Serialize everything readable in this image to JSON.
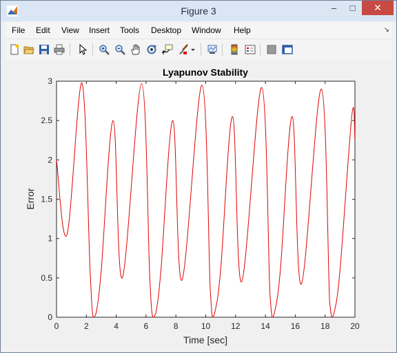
{
  "window": {
    "title": "Figure 3",
    "controls": {
      "minimize": "–",
      "maximize": "□",
      "close": "✕"
    }
  },
  "menu": {
    "items": [
      "File",
      "Edit",
      "View",
      "Insert",
      "Tools",
      "Desktop",
      "Window",
      "Help"
    ],
    "dock_arrow": "↘"
  },
  "toolbar": {
    "icons": [
      "new-figure-icon",
      "open-file-icon",
      "save-icon",
      "print-icon",
      "edit-plot-arrow-icon",
      "zoom-in-icon",
      "zoom-out-icon",
      "pan-hand-icon",
      "rotate-3d-icon",
      "data-cursor-icon",
      "brush-icon",
      "brush-dropdown-icon",
      "link-plot-icon",
      "insert-colorbar-icon",
      "insert-legend-icon",
      "hide-plot-tools-icon",
      "show-plot-tools-icon"
    ]
  },
  "chart_data": {
    "type": "line",
    "title": "Lyapunov Stability",
    "xlabel": "Time [sec]",
    "ylabel": "Error",
    "xlim": [
      0,
      20
    ],
    "ylim": [
      0,
      3
    ],
    "xticks": [
      "0",
      "2",
      "4",
      "6",
      "8",
      "10",
      "12",
      "14",
      "16",
      "18",
      "20"
    ],
    "yticks": [
      "0",
      "0.5",
      "1",
      "1.5",
      "2",
      "2.5",
      "3"
    ],
    "grid": false,
    "color": "#e00000",
    "series": [
      {
        "x": [
          0,
          0.7,
          1.7,
          2.25,
          2.45,
          2.65,
          3.0,
          3.8,
          4.4,
          5.7,
          6.25,
          6.45,
          6.65,
          7.0,
          7.8,
          8.4,
          9.75,
          10.3,
          10.45,
          10.6,
          11.0,
          11.8,
          12.4,
          13.75,
          14.3,
          14.45,
          14.6,
          15.0,
          15.8,
          16.4,
          17.75,
          18.3,
          18.45,
          18.6,
          19.0,
          19.8,
          20.0
        ],
        "y": [
          2.0,
          1.05,
          2.98,
          0.6,
          0.0,
          0.05,
          0.6,
          2.5,
          0.5,
          2.97,
          0.5,
          0.0,
          0.05,
          0.6,
          2.5,
          0.47,
          2.95,
          0.35,
          0.0,
          0.05,
          0.6,
          2.55,
          0.45,
          2.92,
          0.3,
          0.0,
          0.05,
          0.6,
          2.55,
          0.42,
          2.9,
          0.2,
          0.0,
          0.05,
          0.6,
          2.58,
          2.25
        ]
      }
    ]
  }
}
